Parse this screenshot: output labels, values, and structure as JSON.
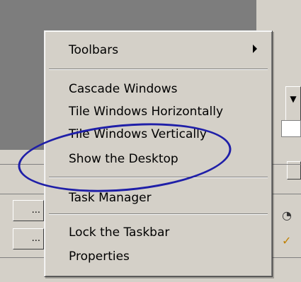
{
  "menu": {
    "items": [
      {
        "label": "Toolbars",
        "has_submenu": true
      },
      {
        "label": "Cascade Windows"
      },
      {
        "label": "Tile Windows Horizontally"
      },
      {
        "label": "Tile Windows Vertically"
      },
      {
        "label": "Show the Desktop"
      },
      {
        "label": "Task Manager"
      },
      {
        "label": "Lock the Taskbar"
      },
      {
        "label": "Properties"
      }
    ]
  },
  "taskbar": {
    "button_label_1": "...",
    "button_label_2": "..."
  },
  "colors": {
    "menu_bg": "#d4d0c8",
    "desktop_gray": "#7d7d7d",
    "annotation": "#1f1fa8"
  },
  "icons": [
    "submenu-arrow-icon",
    "dropdown-arrow-icon",
    "tray-icon-clock",
    "tray-icon-update"
  ]
}
